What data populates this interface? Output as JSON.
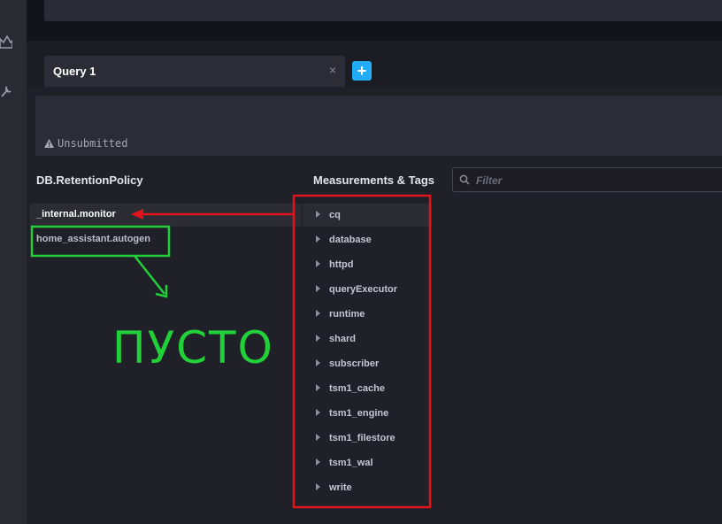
{
  "tab": {
    "title": "Query 1",
    "close": "×"
  },
  "add_tab": "+",
  "editor": {
    "status": "Unsubmitted"
  },
  "db_panel": {
    "title": "DB.RetentionPolicy",
    "items": [
      "_internal.monitor",
      "home_assistant.autogen"
    ]
  },
  "measurements": {
    "title": "Measurements & Tags",
    "filter_placeholder": "Filter",
    "items": [
      "cq",
      "database",
      "httpd",
      "queryExecutor",
      "runtime",
      "shard",
      "subscriber",
      "tsm1_cache",
      "tsm1_engine",
      "tsm1_filestore",
      "tsm1_wal",
      "write"
    ]
  },
  "annotation": {
    "text": "ПУСТО"
  },
  "colors": {
    "accent": "#22adf6",
    "annotation_red": "#e0151b",
    "annotation_green": "#22d03a"
  },
  "icons": [
    "crown-icon",
    "wrench-icon",
    "warning-icon",
    "search-icon",
    "caret-right-icon",
    "plus-icon",
    "close-icon"
  ]
}
